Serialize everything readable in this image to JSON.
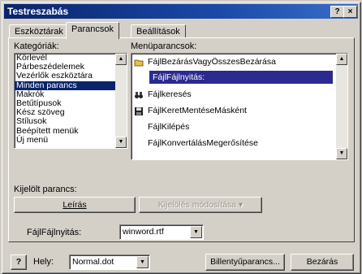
{
  "window": {
    "title": "Testreszabás",
    "help": "?",
    "close": "×"
  },
  "tabs": [
    {
      "label": "Eszköztárak"
    },
    {
      "label": "Parancsok"
    },
    {
      "label": "Beállítások"
    }
  ],
  "categories": {
    "label": "Kategóriák:",
    "items": [
      "Körlevél",
      "Párbeszédelemek",
      "Vezérlők eszköztára",
      "Minden parancs",
      "Makrók",
      "Betűtípusok",
      "Kész szöveg",
      "Stílusok",
      "Beépített menük",
      "Új menü"
    ],
    "selected": "Minden parancs"
  },
  "commands": {
    "label": "Menüparancsok:",
    "items": [
      {
        "text": "FájlBezárásVagyÖsszesBezárása",
        "icon": "folder-icon"
      },
      {
        "text": "FájlFájlnyitás:",
        "icon": "none"
      },
      {
        "text": "Fájlkeresés",
        "icon": "binoculars-icon"
      },
      {
        "text": "FájlKeretMentéseMásként",
        "icon": "floppy-icon"
      },
      {
        "text": "FájlKilépés",
        "icon": "none"
      },
      {
        "text": "FájlKonvertálásMegerősítése",
        "icon": "none"
      }
    ],
    "selected": "FájlFájlnyitás:"
  },
  "selected_command": {
    "label": "Kijelölt parancs:",
    "description_button": "Leírás",
    "modify_button": "Kijelölés módosítása ▾"
  },
  "file_open": {
    "label": "FájlFájlnyitás:",
    "value": "winword.rtf"
  },
  "footer": {
    "save_in_label": "Hely:",
    "save_in_value": "Normal.dot",
    "keyboard_button": "Billentyűparancs...",
    "close_button": "Bezárás"
  },
  "colors": {
    "titlebar": "#0a246a",
    "selection": "#0a246a",
    "dialog": "#d4d0c8"
  }
}
